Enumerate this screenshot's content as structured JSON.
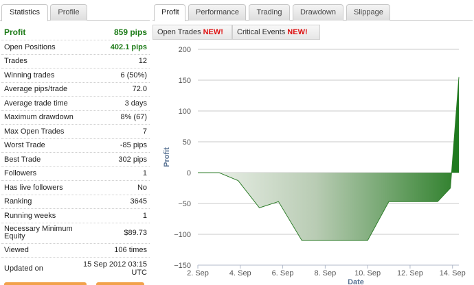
{
  "left_tabs": [
    {
      "label": "Statistics",
      "active": true
    },
    {
      "label": "Profile",
      "active": false
    }
  ],
  "stats": {
    "profit": {
      "label": "Profit",
      "value": "859 pips"
    },
    "open_positions": {
      "label": "Open Positions",
      "value": "402.1 pips"
    },
    "trades": {
      "label": "Trades",
      "value": "12"
    },
    "winning_trades": {
      "label": "Winning trades",
      "value": "6 (50%)"
    },
    "average_pips": {
      "label": "Average pips/trade",
      "value": "72.0"
    },
    "average_trade_time": {
      "label": "Average trade time",
      "value": "3 days"
    },
    "max_drawdown": {
      "label": "Maximum drawdown",
      "value": "8% (67)"
    },
    "max_open_trades": {
      "label": "Max Open Trades",
      "value": "7"
    },
    "worst_trade": {
      "label": "Worst Trade",
      "value": "-85 pips"
    },
    "best_trade": {
      "label": "Best Trade",
      "value": "302 pips"
    },
    "followers": {
      "label": "Followers",
      "value": "1"
    },
    "live_followers": {
      "label": "Has live followers",
      "value": "No"
    },
    "ranking": {
      "label": "Ranking",
      "value": "3645"
    },
    "running_weeks": {
      "label": "Running weeks",
      "value": "1"
    },
    "min_equity": {
      "label": "Necessary Minimum Equity",
      "value": "$89.73"
    },
    "viewed": {
      "label": "Viewed",
      "value": "106 times"
    },
    "updated_on": {
      "label": "Updated on",
      "value": "15 Sep 2012 03:15 UTC"
    }
  },
  "right_tabs": [
    {
      "label": "Profit",
      "active": true
    },
    {
      "label": "Performance",
      "active": false
    },
    {
      "label": "Trading",
      "active": false
    },
    {
      "label": "Drawdown",
      "active": false
    },
    {
      "label": "Slippage",
      "active": false
    }
  ],
  "sub_buttons": [
    {
      "label": "Open Trades",
      "badge": "NEW!"
    },
    {
      "label": "Critical Events",
      "badge": "NEW!"
    }
  ],
  "colors": {
    "profit_green": "#1c7b17",
    "badge_red": "#dd1111",
    "area_dark": "#1f7a1f",
    "area_light": "#dfe8dc"
  },
  "chart_data": {
    "type": "area",
    "title": "",
    "xlabel": "Date",
    "ylabel": "Profit",
    "ylim": [
      -150,
      200
    ],
    "yticks": [
      -150,
      -100,
      -50,
      0,
      50,
      100,
      150,
      200
    ],
    "xlim": [
      2,
      14.3
    ],
    "xticks": [
      {
        "x": 2,
        "label": "2. Sep"
      },
      {
        "x": 4,
        "label": "4. Sep"
      },
      {
        "x": 6,
        "label": "6. Sep"
      },
      {
        "x": 8,
        "label": "8. Sep"
      },
      {
        "x": 10,
        "label": "10. Sep"
      },
      {
        "x": 12,
        "label": "12. Sep"
      },
      {
        "x": 14,
        "label": "14. Sep"
      }
    ],
    "grid": true,
    "series": [
      {
        "x": [
          2,
          3,
          3.9,
          4.9,
          5.8,
          6.9,
          8.0,
          9.0,
          10.0,
          11.0,
          12.0,
          13.3,
          13.9,
          14.3
        ],
        "values": [
          0,
          0,
          -13,
          -57,
          -47,
          -110,
          -110,
          -110,
          -110,
          -47,
          -47,
          -47,
          -25,
          155
        ]
      }
    ]
  }
}
